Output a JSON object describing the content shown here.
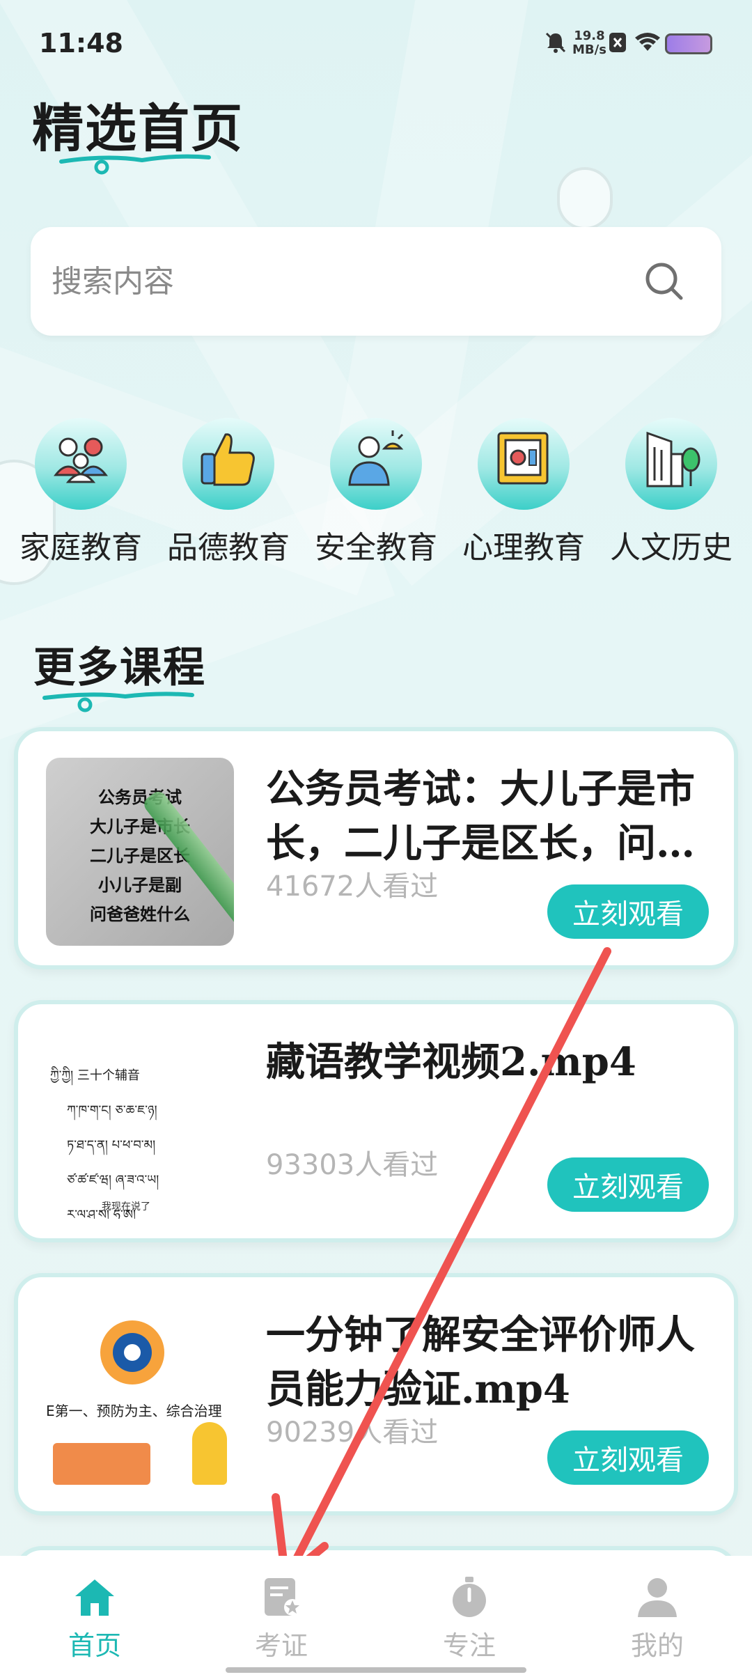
{
  "status_bar": {
    "time": "11:48",
    "net_speed_value": "19.8",
    "net_speed_unit": "MB/s"
  },
  "page_title": "精选首页",
  "search": {
    "placeholder": "搜索内容"
  },
  "categories": [
    {
      "label": "家庭教育",
      "icon": "family-icon"
    },
    {
      "label": "品德教育",
      "icon": "thumbs-up-icon"
    },
    {
      "label": "安全教育",
      "icon": "safety-officer-icon"
    },
    {
      "label": "心理教育",
      "icon": "safe-box-icon"
    },
    {
      "label": "人文历史",
      "icon": "building-tree-icon"
    }
  ],
  "section_title": "更多课程",
  "courses": [
    {
      "title": "公务员考试：大儿子是市长，二儿子是区长，问…",
      "views": "41672人看过",
      "button": "立刻观看",
      "thumb_lines": [
        "公务员考试",
        "大儿子是市长",
        "二儿子是区长",
        "小儿子是副",
        "问爸爸姓什么"
      ]
    },
    {
      "title": "藏语教学视频2.mp4",
      "views": "93303人看过",
      "button": "立刻观看",
      "thumb_lines": [
        "ཀྱི་ཀྱི། 三十个辅音",
        "ཀ་ཁ་ག་ང།   ཅ་ཆ་ཇ་ཉ།",
        "ཏ་ཐ་ད་ན།   པ་ཕ་བ་མ།",
        "ཙ་ཚ་ཛ་ཝ།   ཞ་ཟ་འ་ཡ།",
        "ར་ལ་ཤ་ས།   ཧ་ཨ།",
        "我现在说了"
      ]
    },
    {
      "title": "一分钟了解安全评价师人员能力验证.mp4",
      "views": "90239人看过",
      "button": "立刻观看",
      "thumb_lines": [
        "E第一、预防为主、综合治理"
      ]
    }
  ],
  "tabs": [
    {
      "label": "首页",
      "active": true
    },
    {
      "label": "考证",
      "active": false
    },
    {
      "label": "专注",
      "active": false
    },
    {
      "label": "我的",
      "active": false
    }
  ],
  "colors": {
    "accent": "#20c3bd",
    "tab_active": "#1cb8b3",
    "annotation_arrow": "#ef5350"
  }
}
